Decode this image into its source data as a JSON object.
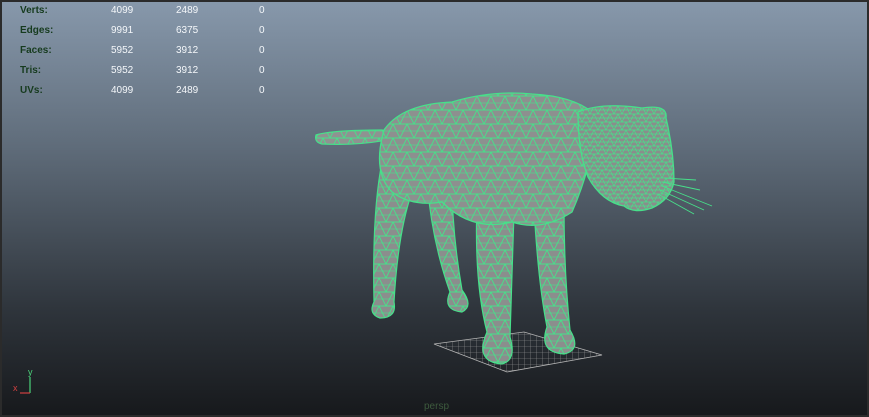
{
  "viewport": {
    "camera": "persp"
  },
  "heads_up": {
    "rows": [
      {
        "label": "Verts:",
        "values": [
          "4099",
          "2489",
          "0"
        ]
      },
      {
        "label": "Edges:",
        "values": [
          "9991",
          "6375",
          "0"
        ]
      },
      {
        "label": "Faces:",
        "values": [
          "5952",
          "3912",
          "0"
        ]
      },
      {
        "label": "Tris:",
        "values": [
          "5952",
          "3912",
          "0"
        ]
      },
      {
        "label": "UVs:",
        "values": [
          "4099",
          "2489",
          "0"
        ]
      }
    ]
  },
  "axis_indicator": {
    "y": "y",
    "x": "x"
  },
  "colors": {
    "wireframe": "#47e08a",
    "mesh_fill": "#8a8d8c",
    "hud_label": "#163b1e",
    "hud_value": "#f4f7fa"
  },
  "icons": [
    "grid-plane-icon",
    "axis-gizmo-icon"
  ]
}
